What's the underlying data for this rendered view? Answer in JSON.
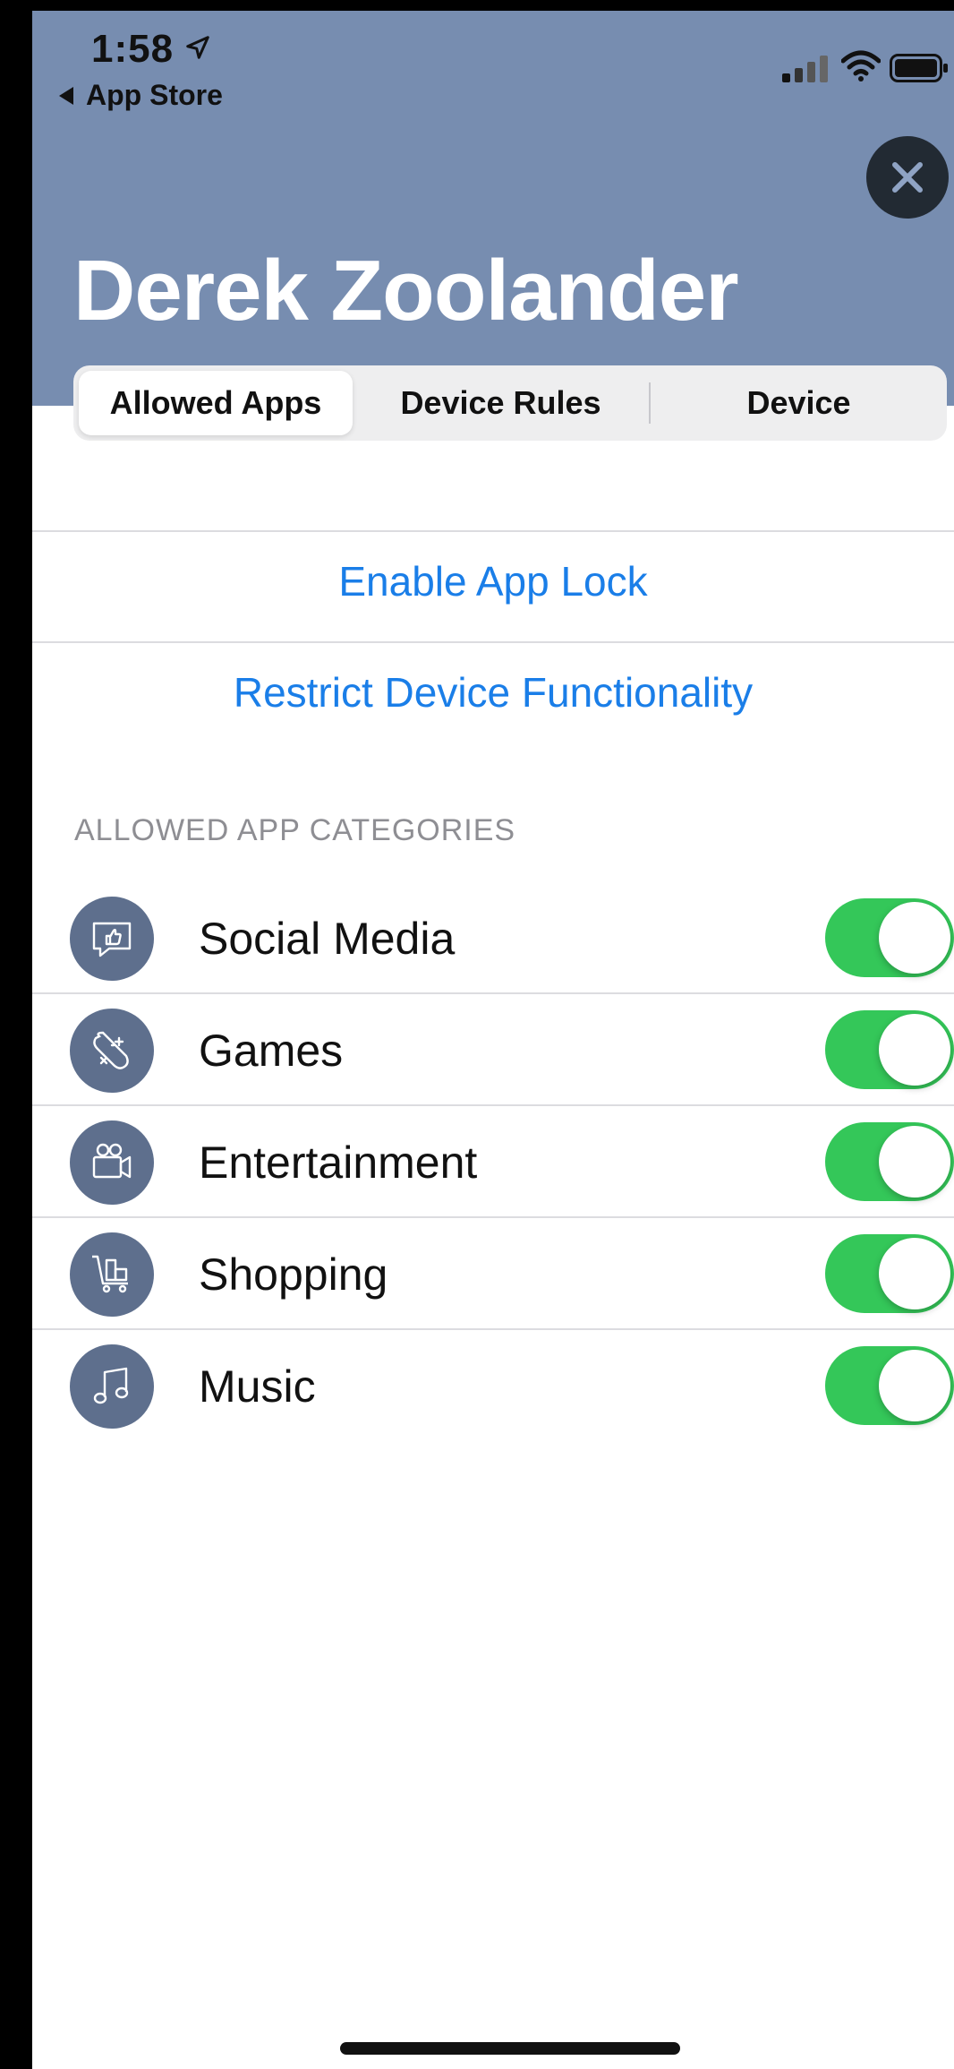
{
  "status_bar": {
    "time": "1:58",
    "back_label": "App Store"
  },
  "header": {
    "title": "Derek Zoolander",
    "close_icon": "close-icon"
  },
  "tabs": [
    {
      "label": "Allowed Apps",
      "active": true
    },
    {
      "label": "Device Rules",
      "active": false
    },
    {
      "label": "Device",
      "active": false
    }
  ],
  "actions": {
    "enable_app_lock": "Enable App Lock",
    "restrict_device": "Restrict Device Functionality"
  },
  "section_title": "ALLOWED APP CATEGORIES",
  "categories": [
    {
      "label": "Social Media",
      "icon": "chat-thumbs-up-icon",
      "enabled": true
    },
    {
      "label": "Games",
      "icon": "gamepad-icon",
      "enabled": true
    },
    {
      "label": "Entertainment",
      "icon": "video-camera-icon",
      "enabled": true
    },
    {
      "label": "Shopping",
      "icon": "shopping-cart-icon",
      "enabled": true
    },
    {
      "label": "Music",
      "icon": "music-note-icon",
      "enabled": true
    }
  ],
  "colors": {
    "header_bg": "#778db0",
    "accent": "#1a7ee8",
    "toggle_on": "#34c759",
    "icon_circle": "#5e6f8d"
  }
}
